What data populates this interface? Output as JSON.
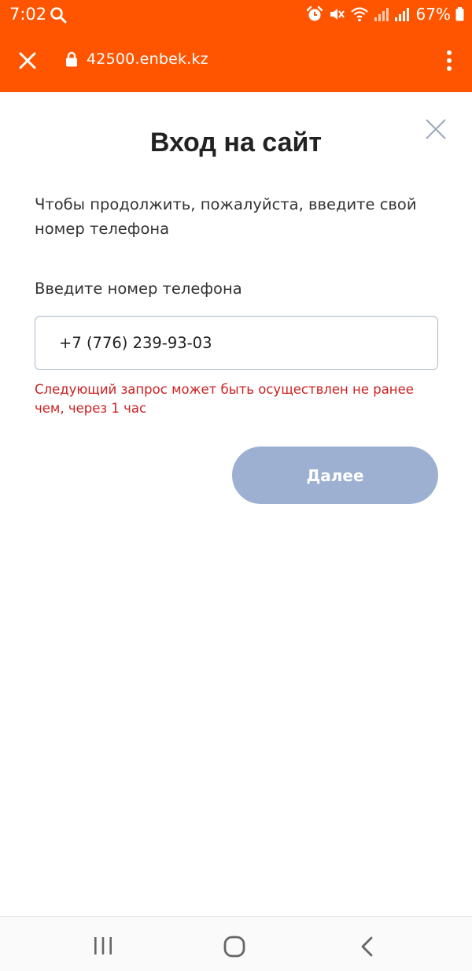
{
  "status_bar": {
    "time": "7:02",
    "battery": "67%"
  },
  "browser": {
    "url": "42500.enbek.kz"
  },
  "modal": {
    "title": "Вход на сайт",
    "intro": "Чтобы продолжить, пожалуйста, введите свой номер телефона",
    "phone_label": "Введите номер телефона",
    "phone_value": "+7 (776) 239-93-03",
    "error": "Следующий запрос может быть осуществлен не ранее чем, через 1 час",
    "next_label": "Далее"
  },
  "colors": {
    "brand": "#ff5500",
    "button": "#9db0d1",
    "error": "#cc2222",
    "input_border": "#a9b6c8"
  },
  "icons": {
    "status": [
      "search-icon",
      "alarm-icon",
      "mute-icon",
      "wifi-icon",
      "signal-icon",
      "battery-icon"
    ],
    "browser": [
      "close-icon",
      "lock-icon",
      "kebab-menu-icon"
    ],
    "modal": [
      "close-icon"
    ],
    "nav": [
      "recent-apps-icon",
      "home-icon",
      "back-icon"
    ]
  }
}
